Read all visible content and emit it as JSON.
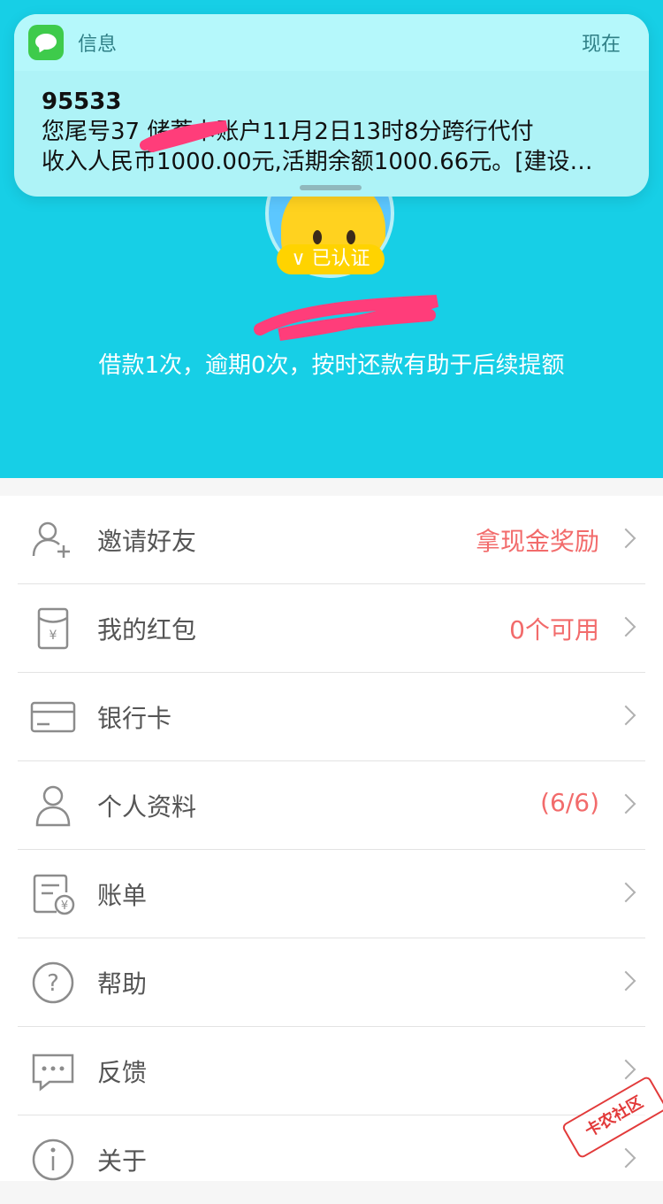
{
  "notification": {
    "app_name": "信息",
    "time": "现在",
    "sender": "95533",
    "message_line1": "您尾号37  储蓄卡账户11月2日13时8分跨行代付",
    "message_line2": "收入人民币1000.00元,活期余额1000.66元。[建设…"
  },
  "profile": {
    "verified_badge": "∨ 已认证",
    "username": "",
    "loan_summary": "借款1次，逾期0次，按时还款有助于后续提额"
  },
  "menu": {
    "items": [
      {
        "label": "邀请好友",
        "value": "拿现金奖励",
        "icon": "invite-user-icon"
      },
      {
        "label": "我的红包",
        "value": "0个可用",
        "icon": "red-packet-icon"
      },
      {
        "label": "银行卡",
        "value": "",
        "icon": "bank-card-icon"
      },
      {
        "label": "个人资料",
        "value": "(6/6)",
        "icon": "person-icon"
      },
      {
        "label": "账单",
        "value": "",
        "icon": "bill-icon"
      },
      {
        "label": "帮助",
        "value": "",
        "icon": "help-icon"
      },
      {
        "label": "反馈",
        "value": "",
        "icon": "feedback-icon"
      },
      {
        "label": "关于",
        "value": "",
        "icon": "info-icon"
      }
    ]
  },
  "watermark": "卡农社区",
  "colors": {
    "header_bg": "#17cfe6",
    "accent_value": "#f26b6b",
    "badge": "#ffd300"
  }
}
